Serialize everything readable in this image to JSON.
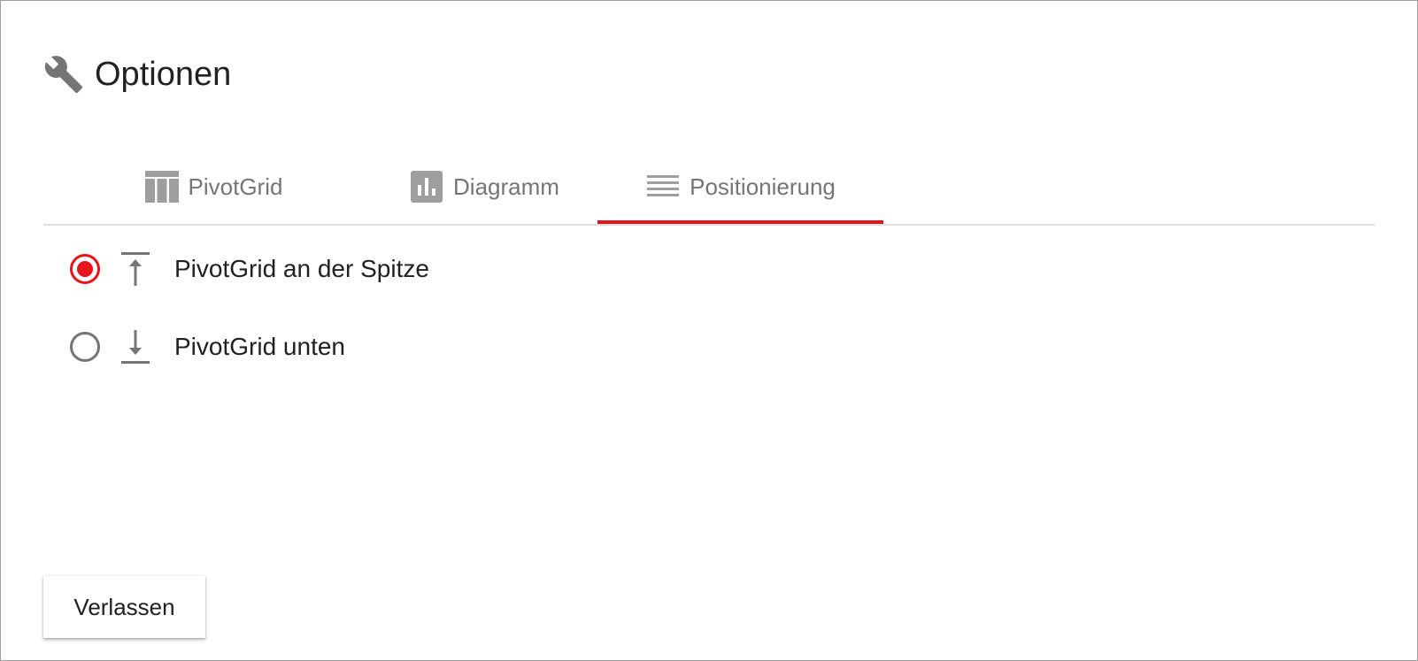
{
  "dialog": {
    "title": "Optionen",
    "title_icon": "wrench-icon"
  },
  "tabs": [
    {
      "label": "PivotGrid",
      "icon": "table-columns-icon",
      "active": false
    },
    {
      "label": "Diagramm",
      "icon": "bar-chart-icon",
      "active": false
    },
    {
      "label": "Positionierung",
      "icon": "lines-list-icon",
      "active": true
    }
  ],
  "positioning": {
    "options": [
      {
        "label": "PivotGrid an der Spitze",
        "icon": "align-top-arrow-icon",
        "selected": true
      },
      {
        "label": "PivotGrid unten",
        "icon": "align-bottom-arrow-icon",
        "selected": false
      }
    ]
  },
  "footer": {
    "exit_label": "Verlassen"
  },
  "colors": {
    "accent": "#e8141c",
    "icon_gray": "#757575",
    "tab_icon_gray": "#9e9e9e",
    "text": "#212121",
    "divider": "#e0e0e0"
  }
}
